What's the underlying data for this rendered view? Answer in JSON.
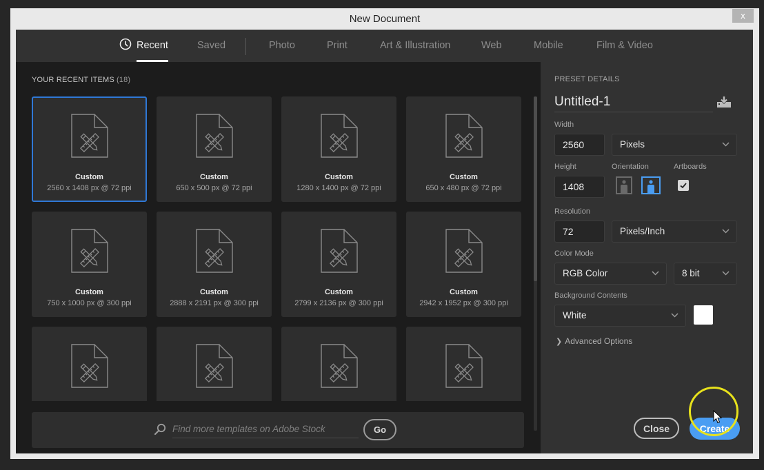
{
  "window": {
    "title": "New Document",
    "close_label": "x"
  },
  "tabs": [
    {
      "label": "Recent",
      "icon": "clock-icon",
      "active": true
    },
    {
      "label": "Saved",
      "active": false
    },
    {
      "label": "Photo",
      "active": false
    },
    {
      "label": "Print",
      "active": false
    },
    {
      "label": "Art & Illustration",
      "active": false
    },
    {
      "label": "Web",
      "active": false
    },
    {
      "label": "Mobile",
      "active": false
    },
    {
      "label": "Film & Video",
      "active": false
    }
  ],
  "recent": {
    "heading": "YOUR RECENT ITEMS",
    "count": "(18)",
    "items": [
      {
        "name": "Custom",
        "dims": "2560 x 1408 px @ 72 ppi",
        "selected": true
      },
      {
        "name": "Custom",
        "dims": "650 x 500 px @ 72 ppi"
      },
      {
        "name": "Custom",
        "dims": "1280 x 1400 px @ 72 ppi"
      },
      {
        "name": "Custom",
        "dims": "650 x 480 px @ 72 ppi"
      },
      {
        "name": "Custom",
        "dims": "750 x 1000 px @ 300 ppi"
      },
      {
        "name": "Custom",
        "dims": "2888 x 2191 px @ 300 ppi"
      },
      {
        "name": "Custom",
        "dims": "2799 x 2136 px @ 300 ppi"
      },
      {
        "name": "Custom",
        "dims": "2942 x 1952 px @ 300 ppi"
      },
      {
        "name": "",
        "dims": ""
      },
      {
        "name": "",
        "dims": ""
      },
      {
        "name": "",
        "dims": ""
      },
      {
        "name": "",
        "dims": ""
      }
    ]
  },
  "stock": {
    "placeholder": "Find more templates on Adobe Stock",
    "go_label": "Go"
  },
  "preset": {
    "heading": "PRESET DETAILS",
    "name": "Untitled-1",
    "width_label": "Width",
    "width_value": "2560",
    "width_unit": "Pixels",
    "height_label": "Height",
    "height_value": "1408",
    "orientation_label": "Orientation",
    "orientation_selected": "landscape",
    "artboards_label": "Artboards",
    "artboards_checked": true,
    "resolution_label": "Resolution",
    "resolution_value": "72",
    "resolution_unit": "Pixels/Inch",
    "color_mode_label": "Color Mode",
    "color_mode": "RGB Color",
    "bit_depth": "8 bit",
    "background_label": "Background Contents",
    "background": "White",
    "background_swatch": "#ffffff",
    "advanced_label": "Advanced Options"
  },
  "actions": {
    "close_label": "Close",
    "create_label": "Create"
  },
  "colors": {
    "accent": "#4a9df2",
    "selection_border": "#2f78d6",
    "click_highlight": "#e8e21c"
  }
}
